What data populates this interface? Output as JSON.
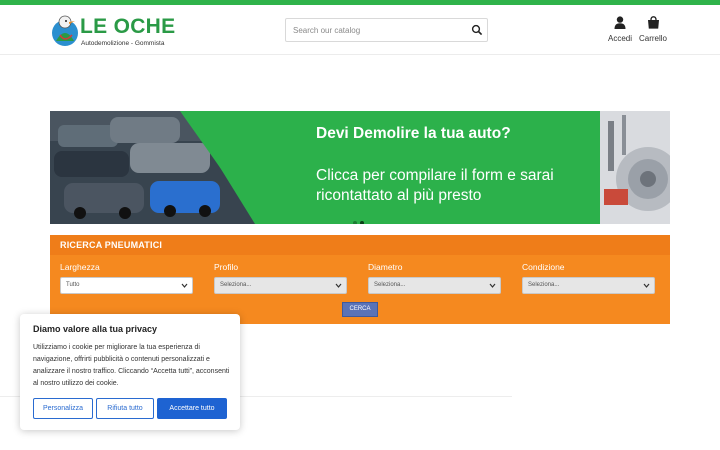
{
  "brand": {
    "name": "LE OCHE",
    "tagline": "Autodemolizione - Gommista",
    "color": "#2a9a46"
  },
  "search": {
    "placeholder": "Search our catalog",
    "icon": "search-icon"
  },
  "header_links": {
    "account": {
      "label": "Accedi",
      "icon": "user-icon"
    },
    "cart": {
      "label": "Carrello",
      "icon": "shopping-bag-icon"
    }
  },
  "banner": {
    "title": "Devi Demolire la tua auto?",
    "text": "Clicca per compilare il form e sarai ricontattato al più presto",
    "slide_count": 2,
    "active_slide": 2,
    "color": "#2cb14b"
  },
  "tyre_search": {
    "heading": "RICERCA PNEUMATICI",
    "color": "#f5891f",
    "fields": [
      {
        "label": "Larghezza",
        "value": "Tutto"
      },
      {
        "label": "Profilo",
        "value": "Seleziona..."
      },
      {
        "label": "Diametro",
        "value": "Seleziona..."
      },
      {
        "label": "Condizione",
        "value": "Seleziona..."
      }
    ],
    "submit_label": "CERCA"
  },
  "cookie_banner": {
    "title": "Diamo valore alla tua privacy",
    "body": "Utilizziamo i cookie per migliorare la tua esperienza di navigazione, offrirti pubblicità o contenuti personalizzati e analizzare il nostro traffico. Cliccando “Accetta tutti”, acconsenti al nostro utilizzo dei cookie.",
    "customize_label": "Personalizza",
    "reject_label": "Rifiuta tutto",
    "accept_label": "Accettare tutto",
    "accent": "#1e63d2"
  }
}
